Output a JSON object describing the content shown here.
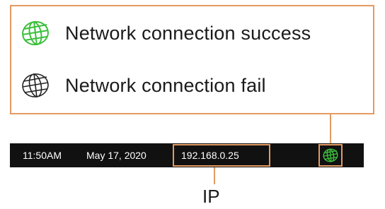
{
  "legend": {
    "success": {
      "label": "Network connection success",
      "icon": "globe-icon",
      "color": "#3bbf3b"
    },
    "fail": {
      "label": "Network connection fail",
      "icon": "globe-icon",
      "color": "#222222"
    }
  },
  "status_bar": {
    "time": "11:50AM",
    "date": "May 17, 2020",
    "ip": "192.168.0.25",
    "network_icon": "globe-icon",
    "network_state": "success"
  },
  "callout": {
    "ip_caption": "IP"
  },
  "colors": {
    "callout_border": "#e39a62",
    "status_bar_bg": "#111111",
    "status_text": "#ffffff",
    "success_icon": "#3bbf3b"
  }
}
